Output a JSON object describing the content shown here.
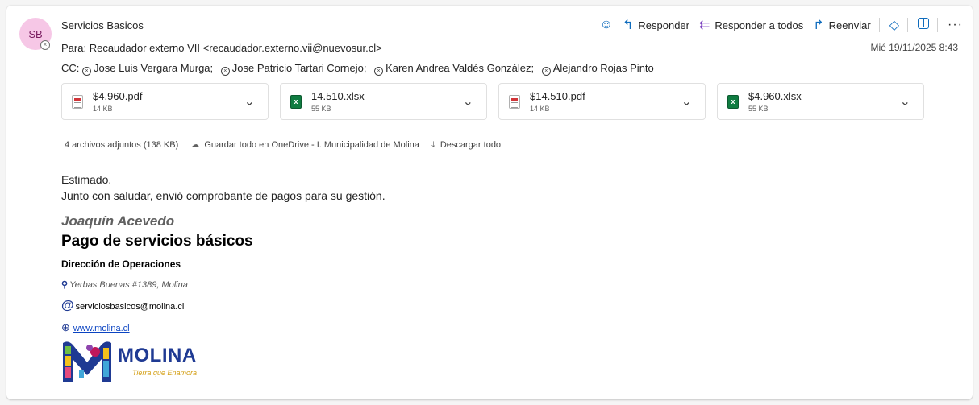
{
  "sender": {
    "initials": "SB",
    "name": "Servicios Basicos"
  },
  "to": {
    "label": "Para:",
    "value": "Recaudador externo VII <recaudador.externo.vii@nuevosur.cl>"
  },
  "cc": {
    "label": "CC:",
    "names": [
      "Jose Luis Vergara Murga;",
      "Jose Patricio Tartari Cornejo;",
      "Karen Andrea Valdés González;",
      "Alejandro Rojas Pinto"
    ]
  },
  "date": "Mié 19/11/2025 8:43",
  "actions": {
    "reply": "Responder",
    "reply_all": "Responder a todos",
    "forward": "Reenviar"
  },
  "attachments": [
    {
      "name": "$4.960.pdf",
      "size": "14 KB",
      "type": "pdf"
    },
    {
      "name": "14.510.xlsx",
      "size": "55 KB",
      "type": "xlsx"
    },
    {
      "name": "$14.510.pdf",
      "size": "14 KB",
      "type": "pdf"
    },
    {
      "name": "$4.960.xlsx",
      "size": "55 KB",
      "type": "xlsx"
    }
  ],
  "attach_bar": {
    "summary": "4 archivos adjuntos (138 KB)",
    "save_all": "Guardar todo en OneDrive - I. Municipalidad de Molina",
    "download_all": "Descargar todo"
  },
  "body": {
    "line1": "Estimado.",
    "line2": "Junto con saludar, envió comprobante de pagos para su gestión."
  },
  "signature": {
    "name": "Joaquín Acevedo",
    "title": "Pago de servicios básicos",
    "department": "Dirección de Operaciones",
    "address": "Yerbas Buenas #1389, Molina",
    "email": "serviciosbasicos@molina.cl",
    "website": "www.molina.cl",
    "logo_word": "MOLINA",
    "logo_tagline": "Tierra que Enamora"
  },
  "colors": {
    "accent": "#0f6cbd",
    "avatar_bg": "#f6c7e6",
    "logo_blue": "#1f3a93"
  }
}
